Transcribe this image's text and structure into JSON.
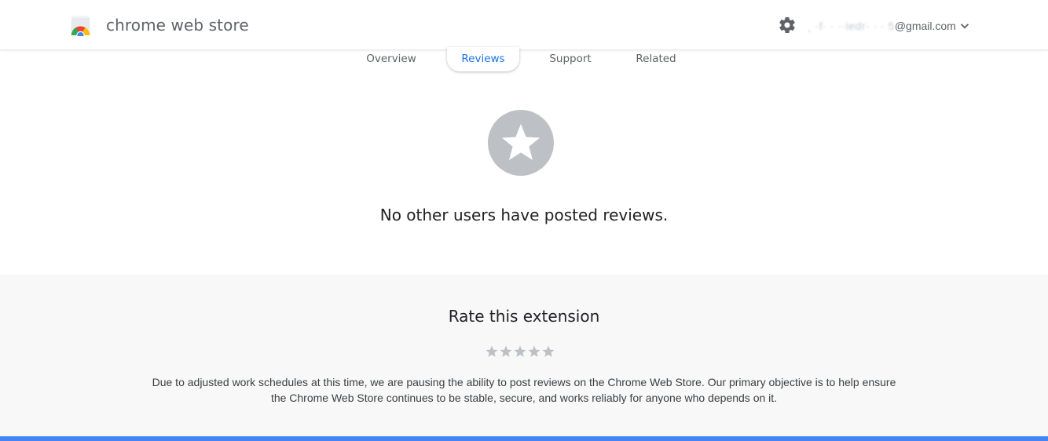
{
  "header": {
    "store_title": "chrome web store",
    "account": {
      "email_obscured": "¸ ·f· · ··iedr· · · 5",
      "email_domain": "@gmail.com"
    },
    "icons": {
      "logo": "chrome-web-store-logo",
      "settings": "gear-icon",
      "account_menu": "chevron-down-icon"
    }
  },
  "tabs": [
    {
      "label": "Overview",
      "active": false
    },
    {
      "label": "Reviews",
      "active": true
    },
    {
      "label": "Support",
      "active": false
    },
    {
      "label": "Related",
      "active": false
    }
  ],
  "reviews": {
    "empty_icon": "star-icon",
    "empty_message": "No other users have posted reviews."
  },
  "rate": {
    "title": "Rate this extension",
    "star_count": 5,
    "selected_rating": 0,
    "notice_line1": "Due to adjusted work schedules at this time, we are pausing the ability to post reviews on the Chrome Web Store. Our primary objective is to help ensure",
    "notice_line2": "the Chrome Web Store continues to be stable, secure, and works reliably for anyone who depends on it."
  },
  "colors": {
    "accent": "#1a73e8",
    "muted_text": "#5f6368",
    "star_gray": "#bdc1c6",
    "panel_bg": "#f8f8f8",
    "bottom_bar": "#4285f4"
  }
}
